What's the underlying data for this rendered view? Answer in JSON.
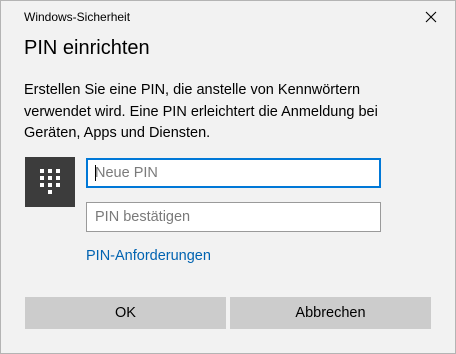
{
  "window": {
    "app_title": "Windows-Sicherheit",
    "close_icon": "close-icon"
  },
  "dialog": {
    "heading": "PIN einrichten",
    "description": "Erstellen Sie eine PIN, die anstelle von Kennwörtern verwendet wird. Eine PIN erleichtert die Anmeldung bei Geräten, Apps und Diensten.",
    "keypad_icon": "keypad-icon",
    "new_pin": {
      "placeholder": "Neue PIN",
      "value": ""
    },
    "confirm_pin": {
      "placeholder": "PIN bestätigen",
      "value": ""
    },
    "requirements_link": "PIN-Anforderungen"
  },
  "buttons": {
    "ok_label": "OK",
    "cancel_label": "Abbrechen"
  },
  "colors": {
    "dialog_background": "#f2f2f2",
    "accent": "#0078d7",
    "link": "#0063b1",
    "button": "#cccccc",
    "keypad_tile": "#3c3c3c"
  }
}
